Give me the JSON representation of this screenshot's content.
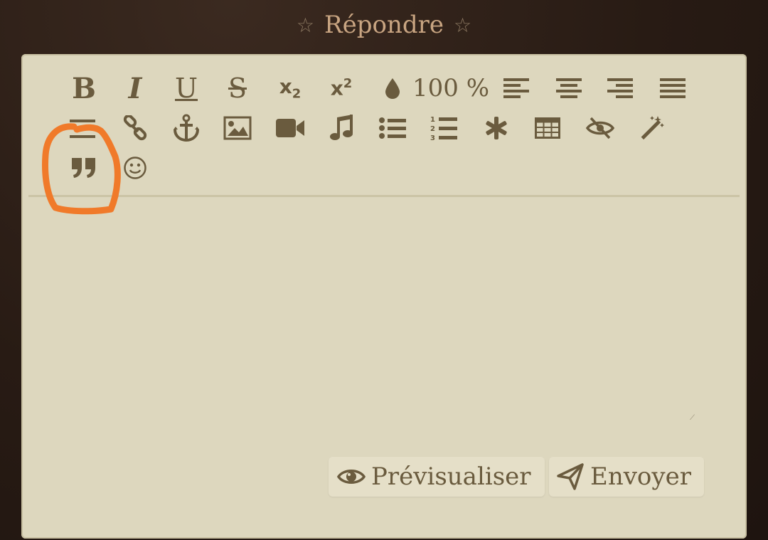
{
  "header": {
    "title": "Répondre"
  },
  "toolbar": {
    "bold": "B",
    "italic": "I",
    "underline": "U",
    "strike": "S",
    "subscript": "x",
    "subscript_sub": "2",
    "superscript": "x",
    "superscript_sup": "2",
    "zoom": "100 %"
  },
  "actions": {
    "preview": "Prévisualiser",
    "send": "Envoyer"
  },
  "colors": {
    "page_bg": "#2a1e17",
    "panel_bg": "#ddd7be",
    "icon": "#6a5b3e",
    "title": "#c9a582",
    "annotation": "#f07a2a"
  },
  "icons": [
    "bold-icon",
    "italic-icon",
    "underline-icon",
    "strikethrough-icon",
    "subscript-icon",
    "superscript-icon",
    "color-drop-icon",
    "align-left-icon",
    "align-center-icon",
    "align-right-icon",
    "justify-icon",
    "hr-icon",
    "link-icon",
    "anchor-icon",
    "image-icon",
    "video-icon",
    "music-icon",
    "bullet-list-icon",
    "numbered-list-icon",
    "asterisk-icon",
    "table-icon",
    "hidden-eye-icon",
    "magic-wand-icon",
    "quote-icon",
    "smiley-icon",
    "eye-icon",
    "send-icon"
  ]
}
